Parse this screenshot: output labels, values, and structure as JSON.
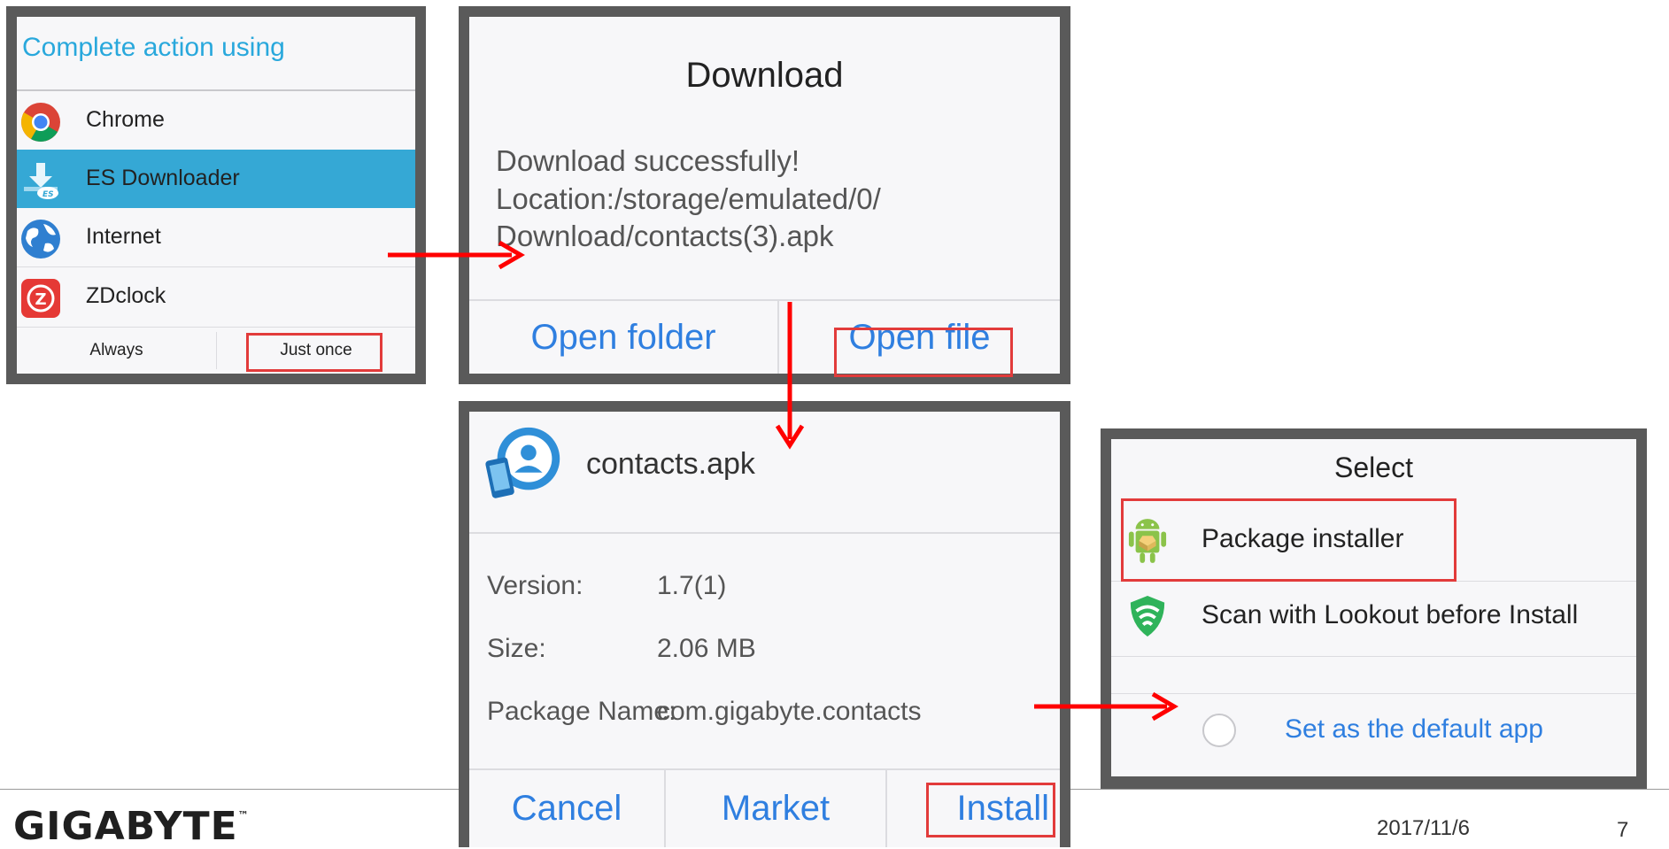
{
  "chooser": {
    "title": "Complete action using",
    "items": [
      {
        "label": "Chrome",
        "icon": "chrome-icon"
      },
      {
        "label": "ES Downloader",
        "icon": "es-downloader-icon",
        "selected": true
      },
      {
        "label": "Internet",
        "icon": "globe-icon"
      },
      {
        "label": "ZDclock",
        "icon": "zdclock-icon"
      }
    ],
    "always_label": "Always",
    "just_once_label": "Just once"
  },
  "download_dialog": {
    "title": "Download",
    "message_line1": "Download  successfully!",
    "message_line2": "Location:/storage/emulated/0/",
    "message_line3": "Download/contacts(3).apk",
    "open_folder_label": "Open folder",
    "open_file_label": "Open file"
  },
  "apk_dialog": {
    "file_name": "contacts.apk",
    "version_label": "Version:",
    "version_value": "1.7(1)",
    "size_label": "Size:",
    "size_value": "2.06 MB",
    "package_label": "Package Name:",
    "package_value": "com.gigabyte.contacts",
    "cancel_label": "Cancel",
    "market_label": "Market",
    "install_label": "Install"
  },
  "select_dialog": {
    "title": "Select",
    "option1": "Package installer",
    "option2": "Scan with Lookout before Install",
    "default_app_label": "Set as the default app"
  },
  "footer": {
    "logo": "GIGABYTE",
    "logo_tm": "™",
    "date": "2017/11/6",
    "page_number": "7"
  },
  "colors": {
    "highlight": "#e23b3b",
    "arrow": "#ff0000",
    "selected_row": "#35a8d5",
    "android_blue": "#2f7fe0",
    "chooser_title": "#29a8dc"
  }
}
